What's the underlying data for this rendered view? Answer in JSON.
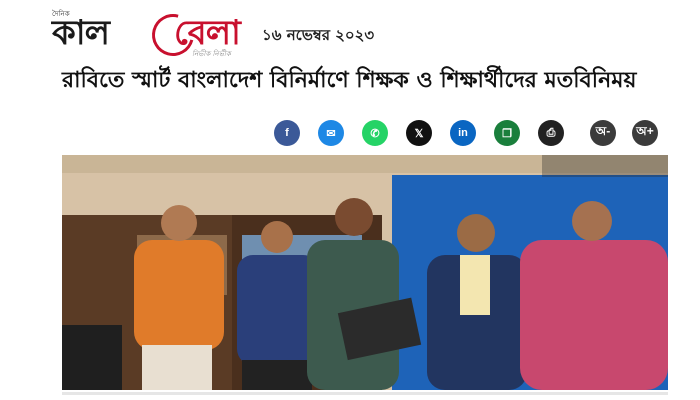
{
  "masthead": {
    "tagline": "দৈনিক",
    "logo_left": "কাল",
    "logo_right": "বেলা",
    "logo_subtitle": "নিভীক নির্ভীক"
  },
  "date": "১৬ নভেম্বর ২০২৩",
  "headline": "রাবিতে স্মার্ট বাংলাদেশ বিনির্মাণে শিক্ষক ও শিক্ষার্থীদের মতবিনিময়",
  "share_buttons": [
    {
      "name": "facebook",
      "glyph": "f",
      "color": "#3b5998"
    },
    {
      "name": "messenger",
      "glyph": "✉",
      "color": "#1e88e5"
    },
    {
      "name": "whatsapp",
      "glyph": "✆",
      "color": "#25d366"
    },
    {
      "name": "x",
      "glyph": "𝕏",
      "color": "#111111"
    },
    {
      "name": "linkedin",
      "glyph": "in",
      "color": "#0a66c2"
    },
    {
      "name": "copy",
      "glyph": "❐",
      "color": "#1a7f3c"
    },
    {
      "name": "print",
      "glyph": "⎙",
      "color": "#222222"
    }
  ],
  "font_buttons": [
    "অ-",
    "অ+"
  ],
  "photo_colors": {
    "wall": "#d7c2a6",
    "curtain": "#1e63b8",
    "shelf": "#5a3b25"
  }
}
